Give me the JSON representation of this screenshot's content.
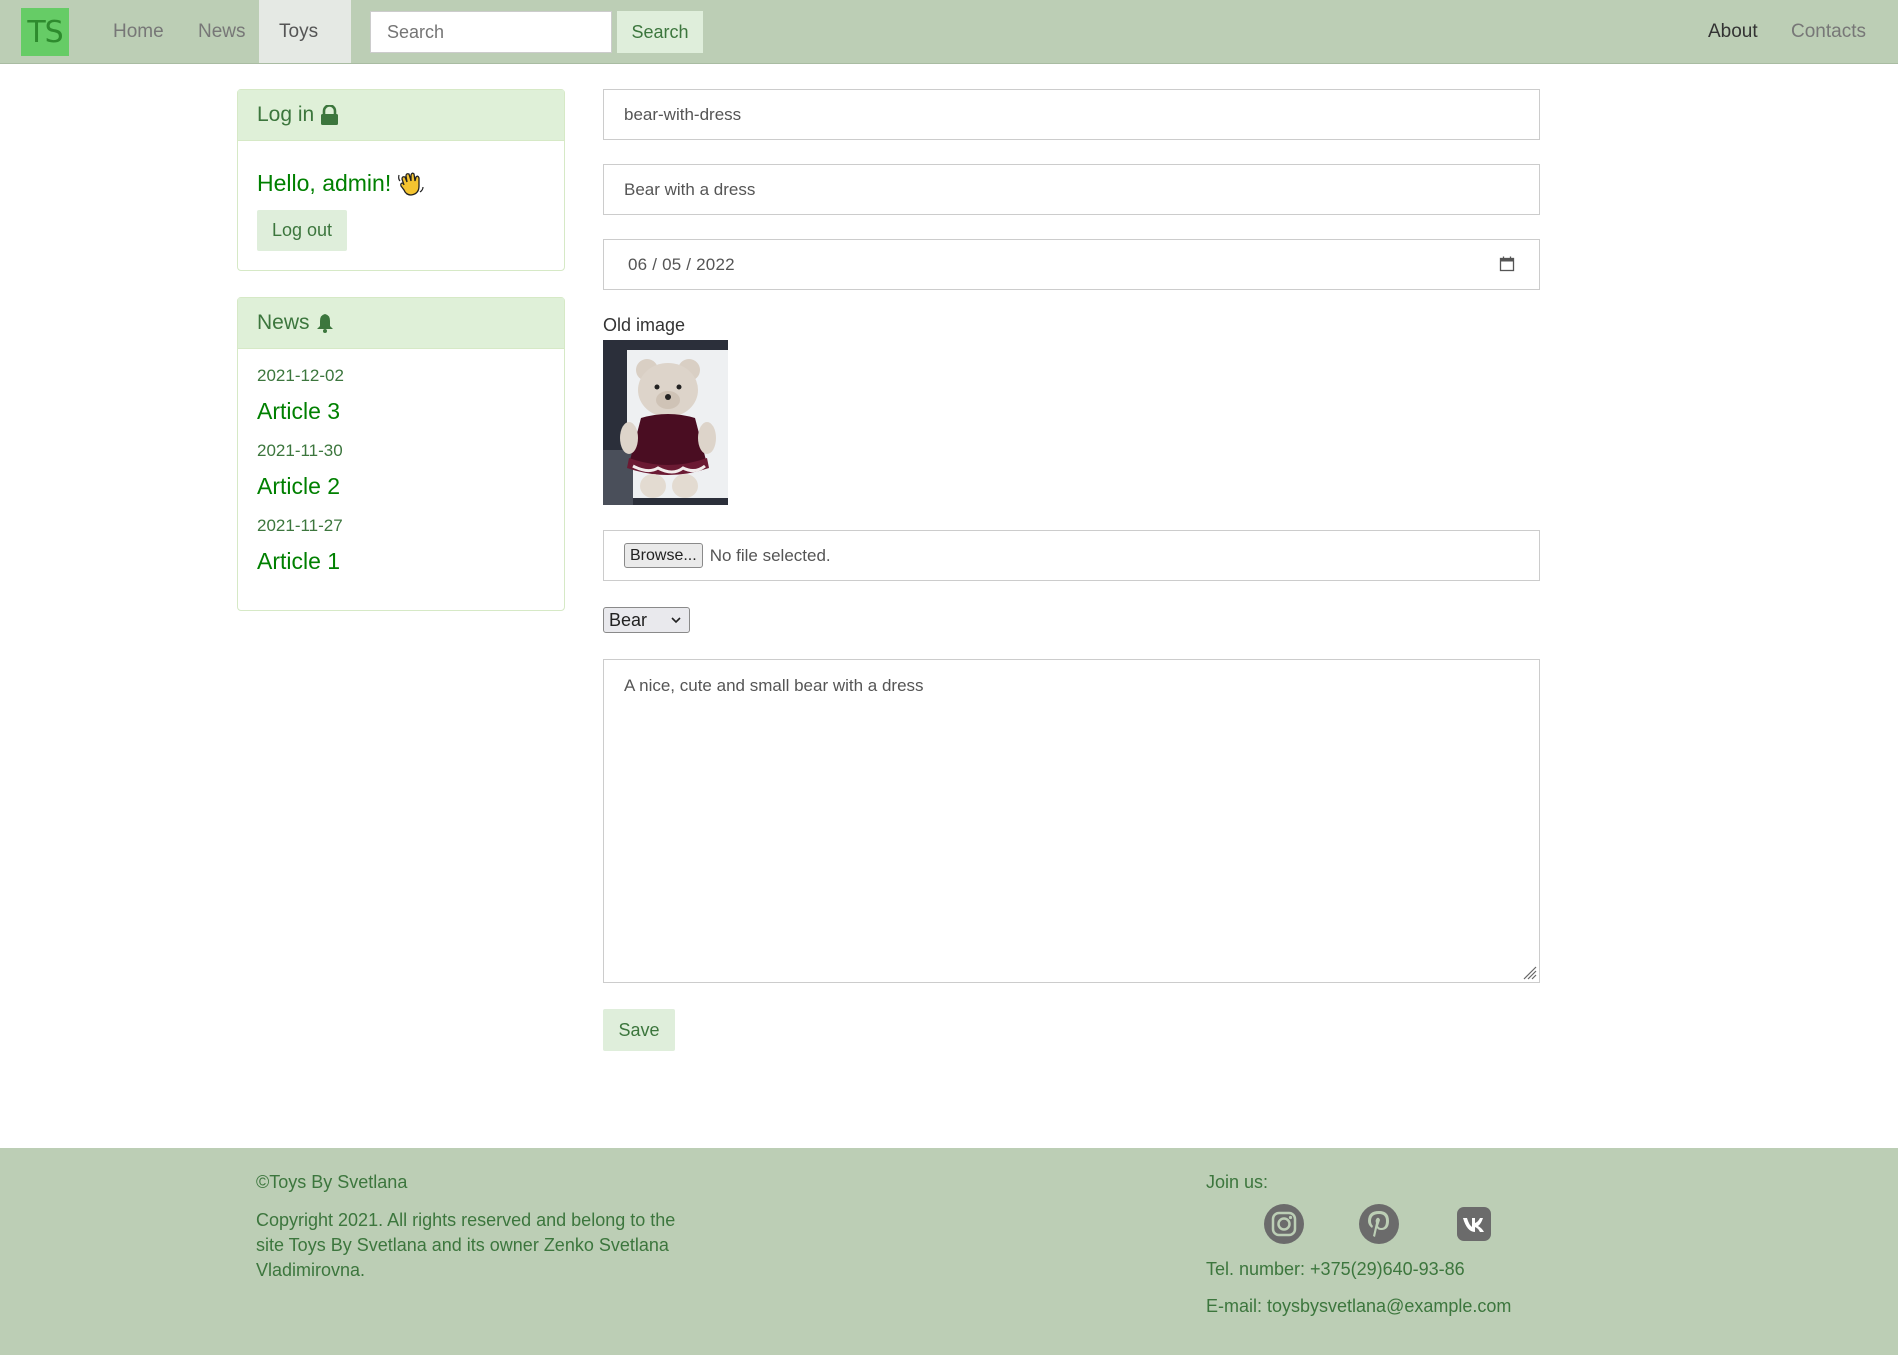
{
  "navbar": {
    "brand": "TS",
    "links": {
      "home": "Home",
      "news": "News",
      "toys": "Toys"
    },
    "search": {
      "placeholder": "Search",
      "button": "Search"
    },
    "right": {
      "about": "About",
      "contacts": "Contacts"
    }
  },
  "login_panel": {
    "title": "Log in",
    "greeting": "Hello, admin!",
    "logout": "Log out"
  },
  "news_panel": {
    "title": "News",
    "items": [
      {
        "date": "2021-12-02",
        "title": "Article 3"
      },
      {
        "date": "2021-11-30",
        "title": "Article 2"
      },
      {
        "date": "2021-11-27",
        "title": "Article 1"
      }
    ]
  },
  "form": {
    "slug": "bear-with-dress",
    "name": "Bear with a dress",
    "date": "06 / 05 / 2022",
    "old_image_label": "Old image",
    "file": {
      "button": "Browse...",
      "status": "No file selected."
    },
    "category": "Bear",
    "description": "A nice, cute and small bear with a dress",
    "save": "Save"
  },
  "footer": {
    "copyright_title": "©Toys By Svetlana",
    "copyright_text": "Copyright 2021. All rights reserved and belong to the site Toys By Svetlana and its owner Zenko Svetlana Vladimirovna.",
    "join": "Join us:",
    "social": [
      "instagram-icon",
      "pinterest-icon",
      "vk-icon"
    ],
    "tel": "Tel. number: +375(29)640-93-86",
    "email": "E-mail: toysbysvetlana@example.com"
  },
  "colors": {
    "navbar_bg": "#bcceb5",
    "accent_green": "#3c763d",
    "link_green": "#008000",
    "panel_head": "#dff0d8"
  }
}
